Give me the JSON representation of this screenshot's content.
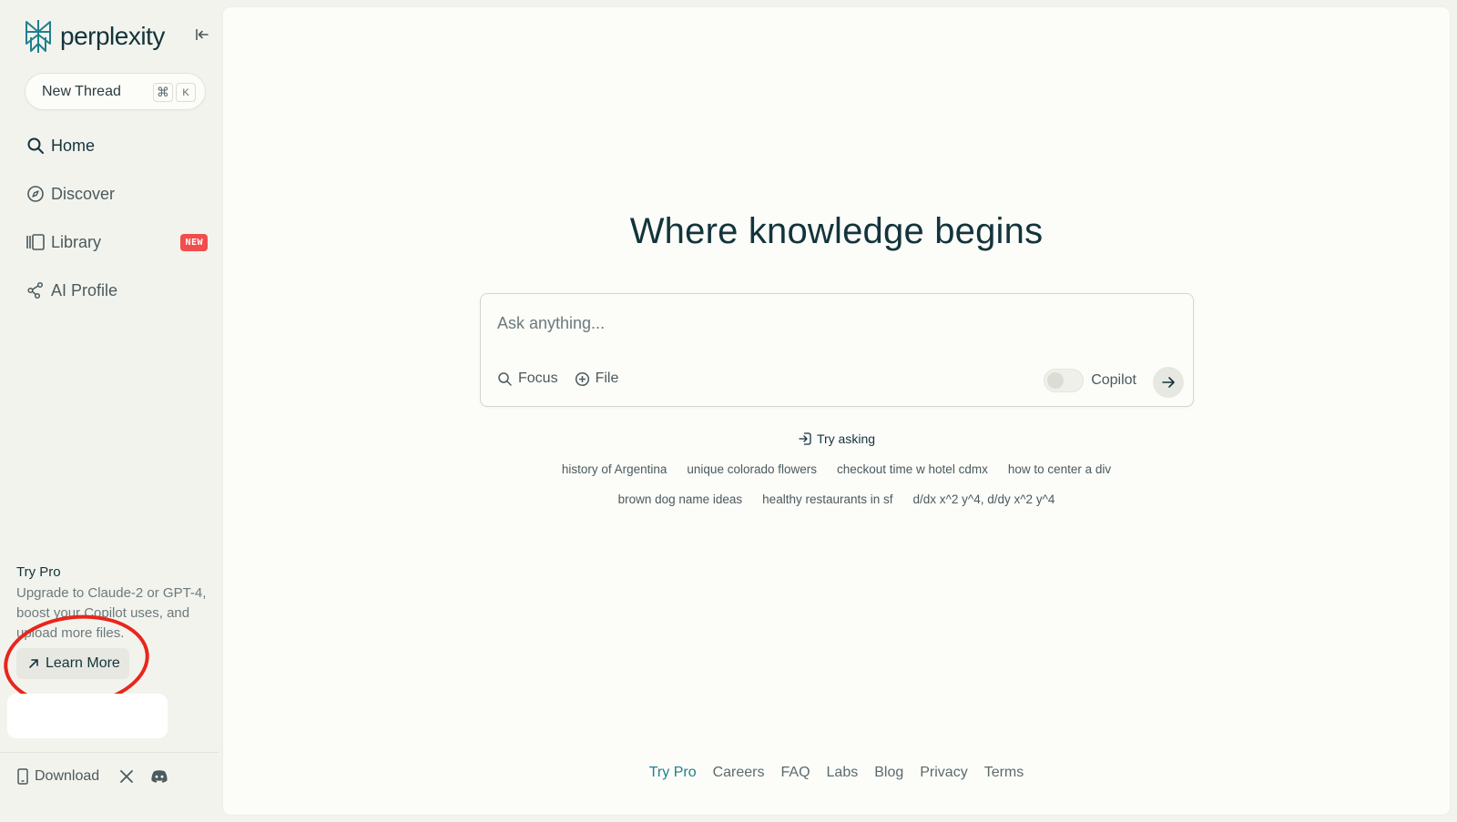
{
  "brand": {
    "name": "perplexity",
    "accent": "#20808d"
  },
  "sidebar": {
    "new_thread": {
      "label": "New Thread",
      "shortcut_cmd": "⌘",
      "shortcut_key": "K"
    },
    "nav": [
      {
        "label": "Home",
        "icon": "search-icon"
      },
      {
        "label": "Discover",
        "icon": "compass-icon"
      },
      {
        "label": "Library",
        "icon": "library-icon",
        "badge": "NEW"
      },
      {
        "label": "AI Profile",
        "icon": "share-icon"
      }
    ],
    "try_pro": {
      "title": "Try Pro",
      "description": "Upgrade to Claude-2 or GPT-4, boost your Copilot uses, and upload more files.",
      "button": "Learn More"
    },
    "footer": {
      "download": "Download"
    }
  },
  "main": {
    "headline": "Where knowledge begins",
    "search": {
      "placeholder": "Ask anything...",
      "focus": "Focus",
      "file": "File",
      "copilot": "Copilot"
    },
    "try_asking": "Try asking",
    "suggestions_row1": [
      "history of Argentina",
      "unique colorado flowers",
      "checkout time w hotel cdmx",
      "how to center a div"
    ],
    "suggestions_row2": [
      "brown dog name ideas",
      "healthy restaurants in sf",
      "d/dx x^2 y^4, d/dy x^2 y^4"
    ],
    "footer_links": [
      "Try Pro",
      "Careers",
      "FAQ",
      "Labs",
      "Blog",
      "Privacy",
      "Terms"
    ]
  }
}
